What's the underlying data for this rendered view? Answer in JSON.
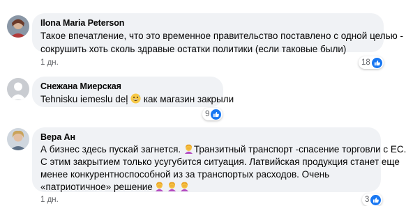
{
  "colors": {
    "bubble_bg": "#f0f2f5",
    "meta_text": "#65676b",
    "like_blue": "#1877f2"
  },
  "comments": [
    {
      "author": "Ilona Maria Peterson",
      "line1": "Такое впечатление, что это временное правительство поставлено с одной целью -",
      "line2": "сокрушить хоть сколь здравые остатки политики (если таковые были)",
      "time": "1 дн.",
      "reactions": "18",
      "reaction_icon": "like-icon"
    },
    {
      "author": "Снежана Миерская",
      "text_a": "Tehnisku iemeslu deļ ",
      "emoji": "grinning-sweat-face",
      "text_b": " как магазин закрыли",
      "reactions": "9",
      "reaction_icon": "like-icon"
    },
    {
      "author": "Вера Ан",
      "line1_a": "А бизнес здесь пускай загнется. ",
      "line1_emoji": "facepalm-woman",
      "line1_b": "Транзитный транспорт -спасение торговли с ЕС.",
      "line2": "С этим закрытием только усугубится ситуация. Латвийская продукция станет еще",
      "line3": "менее конкурентноспособной из за транспортых расходов. Очень",
      "line4": "«патриотичное» решение",
      "line4_emojis": [
        "facepalm-woman",
        "facepalm-woman",
        "facepalm-woman"
      ],
      "time": "1 дн.",
      "reactions": "3",
      "reaction_icon": "like-icon"
    }
  ]
}
